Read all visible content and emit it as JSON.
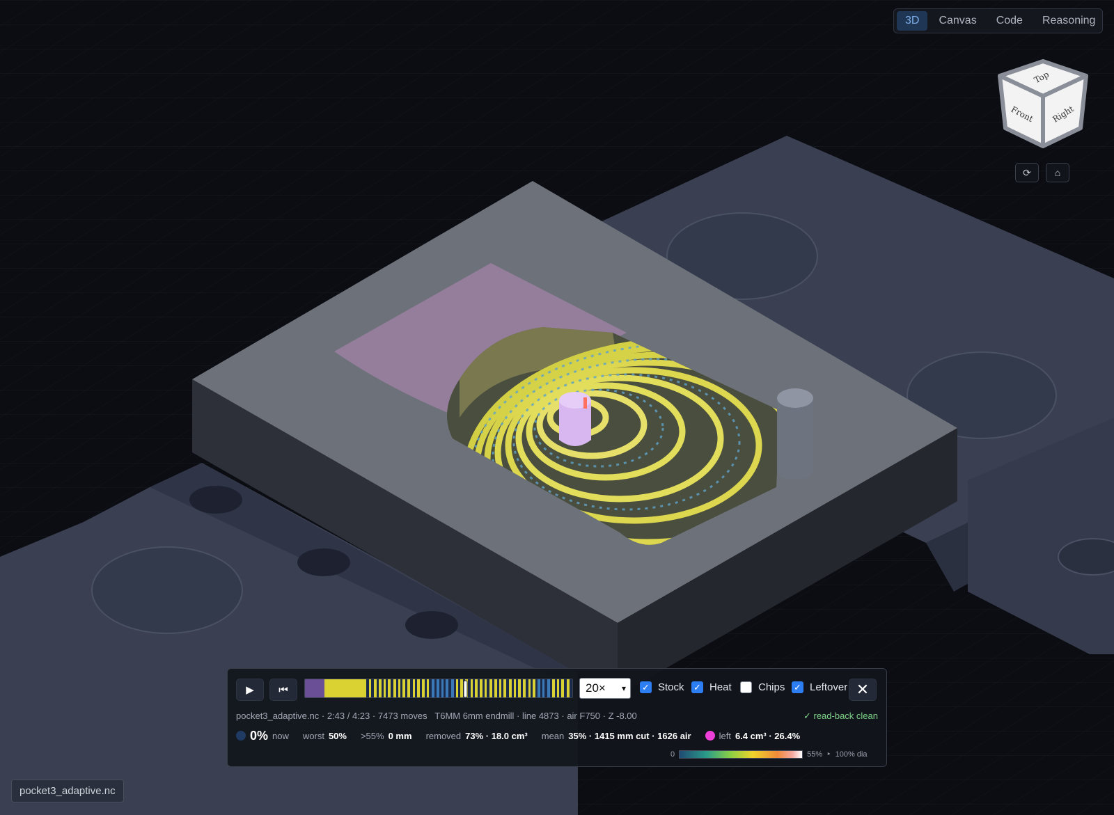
{
  "tabs": [
    "3D",
    "Canvas",
    "Code",
    "Reasoning"
  ],
  "active_tab": "3D",
  "view_cube": {
    "top": "Top",
    "front": "Front",
    "right": "Right"
  },
  "cube_controls": {
    "rotate_icon": "rotate-icon",
    "home_icon": "home-icon",
    "rotate": "⟳",
    "home": "⌂"
  },
  "controls": {
    "play": "▶",
    "rewind": "⏮",
    "speed": "20×",
    "close": "✕",
    "stock_label": "Stock",
    "stock_checked": true,
    "heat_label": "Heat",
    "heat_checked": true,
    "chips_label": "Chips",
    "chips_checked": false,
    "leftover_label": "Leftover",
    "leftover_checked": true
  },
  "timeline_progress": 0.54,
  "status": {
    "file": "pocket3_adaptive.nc",
    "time": "2:43 / 4:23",
    "moves": "7473 moves",
    "tool": "T6MM 6mm endmill",
    "line": "line 4873",
    "feed": "air F750",
    "z": "Z -8.00",
    "readback": "✓ read-back clean"
  },
  "stats": {
    "now_value": "0%",
    "now_label": "now",
    "worst_label": "worst",
    "worst_value": "50%",
    "over_label": ">55%",
    "over_value": "0 mm",
    "removed_label": "removed",
    "removed_value": "73% · 18.0 cm³",
    "mean_label": "mean",
    "mean_value": "35% · 1415 mm cut · 1626 air",
    "left_label": "left",
    "left_value": "6.4 cm³ · 26.4%"
  },
  "legend": {
    "min": "0",
    "max": "55%",
    "arrow": "‣",
    "dia": "100% dia"
  },
  "file_badge": "pocket3_adaptive.nc"
}
